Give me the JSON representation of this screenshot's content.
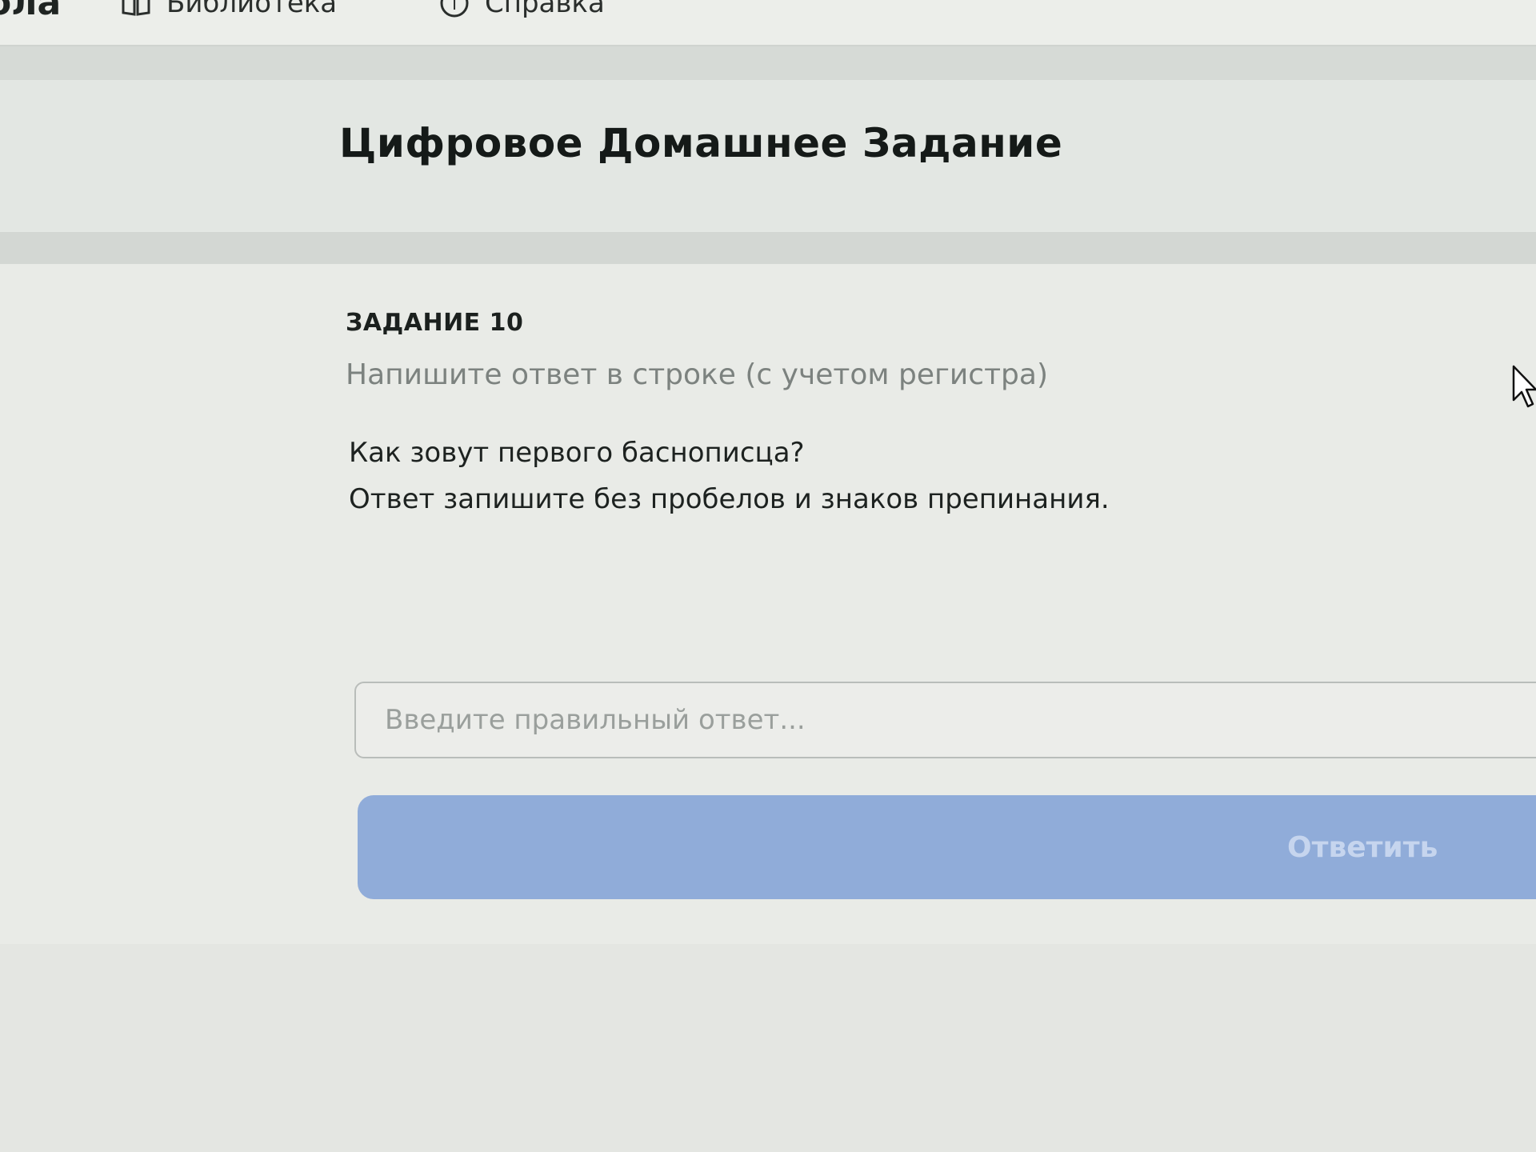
{
  "nav": {
    "brand_fragment": "ола",
    "items": [
      {
        "label": "Библиотека",
        "icon": "book-icon"
      },
      {
        "label": "Справка",
        "icon": "help-icon"
      }
    ]
  },
  "header": {
    "title": "Цифровое Домашнее Задание"
  },
  "task": {
    "label": "ЗАДАНИЕ 10",
    "hint": "Напишите ответ в строке (с учетом регистра)",
    "question_lines": [
      "Как зовут первого баснописца?",
      "Ответ запишите без пробелов и знаков препинания."
    ]
  },
  "answer": {
    "placeholder": "Введите правильный ответ...",
    "value": ""
  },
  "submit": {
    "label": "Ответить",
    "state": "disabled"
  },
  "colors": {
    "button_bg": "#90acd9",
    "button_text": "#c6d5ee",
    "title_text": "#151a18",
    "hint_text": "#7c827f"
  }
}
